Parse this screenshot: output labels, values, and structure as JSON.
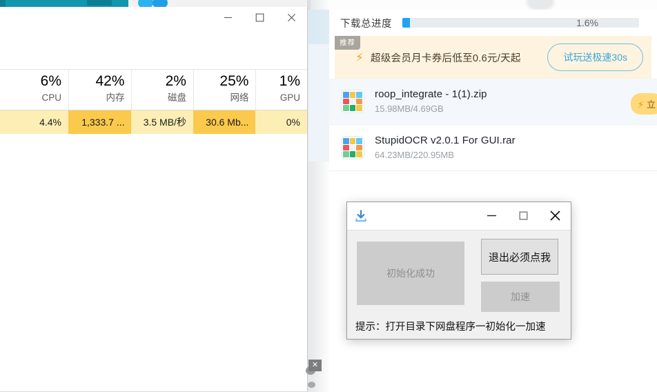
{
  "desktop": {
    "accent_teal": "#1296ad",
    "accent_blue": "#22a2f2"
  },
  "task_manager": {
    "window_title": "",
    "window_buttons": {
      "minimize": "minimize-icon",
      "maximize": "maximize-icon",
      "close": "close-icon"
    },
    "columns": [
      {
        "percent": "6%",
        "name": "CPU",
        "value": "4.4%",
        "value_heat": "warm"
      },
      {
        "percent": "42%",
        "name": "内存",
        "value": "1,333.7 ...",
        "value_heat": "hot"
      },
      {
        "percent": "2%",
        "name": "磁盘",
        "value": "3.5 MB/秒",
        "value_heat": "warm"
      },
      {
        "percent": "25%",
        "name": "网络",
        "value": "30.6 Mb...",
        "value_heat": "hot"
      },
      {
        "percent": "1%",
        "name": "GPU",
        "value": "0%",
        "value_heat": "warm"
      }
    ]
  },
  "downloader": {
    "progress": {
      "label": "下载总进度",
      "percent_text": "1.6%",
      "percent_value": 1.6,
      "fill_color": "#22a2f2",
      "track_color": "#e9ecef"
    },
    "ad": {
      "tag": "推荐",
      "icon": "bolt-icon",
      "text": "超级会员月卡券后低至0.6元/天起",
      "cta_label": "试玩送极速30s",
      "background": "#fdf3df",
      "cta_color": "#3ca7de"
    },
    "files": [
      {
        "icon": "archive-file-icon",
        "name": "roop_integrate - 1(1).zip",
        "progress_text": "15.98MB/4.69GB",
        "selected": true,
        "action_pill": "立",
        "action_pill_icon": "bolt-icon"
      },
      {
        "icon": "archive-file-icon",
        "name": "StupidOCR v2.0.1 For GUI.rar",
        "progress_text": "64.23MB/220.95MB",
        "selected": false,
        "action_pill": "",
        "action_pill_icon": ""
      }
    ]
  },
  "tool_dialog": {
    "title_icon": "download-icon",
    "window_buttons": {
      "minimize": "minimize-icon",
      "maximize": "maximize-icon",
      "close": "close-icon"
    },
    "status_text": "初始化成功",
    "primary_button": "退出必须点我",
    "secondary_button": "加速",
    "hint": "提示：打开目录下网盘程序一初始化一加速"
  },
  "mini_close": {
    "label": "✕"
  }
}
